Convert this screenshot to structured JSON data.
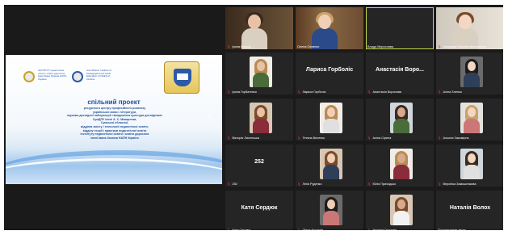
{
  "slide": {
    "institution_left": "ІНСТИТУТ педагогічної освіти і освіти дорослих імені Івана Зязюна НАПН України",
    "institution_right": "Ivan Ziaziun Institute of Pedagogical and Adult Education of NAES of Ukraine",
    "title": "спільний проект",
    "lines": [
      "ресурсного центру професійного розвитку",
      "української мови і літератури,",
      "науково-дослідної лабораторії «Академічна культура дослідника»",
      "СумДПУ імені А. С. Макаренка,",
      "Сумської обласної,",
      "відділів змісту і технології педагогічної освіти;",
      "відділу теорії і практики педагогічної освіти",
      "Інституту педагогічної освіти і освіти дорослих",
      "імені Івана Зязюна НАПН України"
    ]
  },
  "participants": [
    {
      "name": "Ірина Кольце...",
      "muted": true,
      "style": "video",
      "active": false
    },
    {
      "name": "Олена Семеног",
      "muted": false,
      "style": "video",
      "active": false
    },
    {
      "name": "Влада Мирослава",
      "muted": false,
      "style": "dark",
      "active": true
    },
    {
      "name": "Чикарова Марина Миколаївна",
      "muted": true,
      "style": "video",
      "active": false
    },
    {
      "name": "Ірина Горбатенко",
      "muted": true,
      "style": "photo",
      "active": false
    },
    {
      "name": "Лариса Горболіс",
      "muted": true,
      "style": "text",
      "big": "Лариса Горболіс",
      "active": false
    },
    {
      "name": "Анастасія Воронова",
      "muted": true,
      "style": "text",
      "big": "Анастасія Воро...",
      "active": false
    },
    {
      "name": "Аліна Зленко",
      "muted": true,
      "style": "photo",
      "active": false
    },
    {
      "name": "Вікторія Лисенська",
      "muted": true,
      "style": "photo",
      "active": false
    },
    {
      "name": "Тетяна Весенко",
      "muted": true,
      "style": "photo",
      "active": false
    },
    {
      "name": "Аліна Сірена",
      "muted": true,
      "style": "photo",
      "active": false
    },
    {
      "name": "Альона Закомірна",
      "muted": true,
      "style": "photo",
      "active": false
    },
    {
      "name": "252",
      "muted": true,
      "style": "text",
      "big": "252",
      "active": false
    },
    {
      "name": "Лілія Руденко",
      "muted": true,
      "style": "photo",
      "active": false
    },
    {
      "name": "Юлія Приходько",
      "muted": true,
      "style": "photo",
      "active": false
    },
    {
      "name": "Вероніка Замошникова",
      "muted": true,
      "style": "photo",
      "active": false
    },
    {
      "name": "Катя Сердюк",
      "muted": true,
      "style": "text",
      "big": "Катя Сердюк",
      "active": false
    },
    {
      "name": "Olena Kurneda",
      "muted": true,
      "style": "photo",
      "active": false
    },
    {
      "name": "Наталія Громова",
      "muted": true,
      "style": "photo",
      "active": false
    },
    {
      "name": "Подключение звука",
      "muted": false,
      "style": "text",
      "big": "Наталія Волох",
      "active": false
    }
  ],
  "colors": {
    "background": "#1a1a1a",
    "tile": "#252525",
    "active_speaker": "#c6d94b",
    "muted_icon": "#e53935",
    "slide_text": "#1f4f9a"
  }
}
